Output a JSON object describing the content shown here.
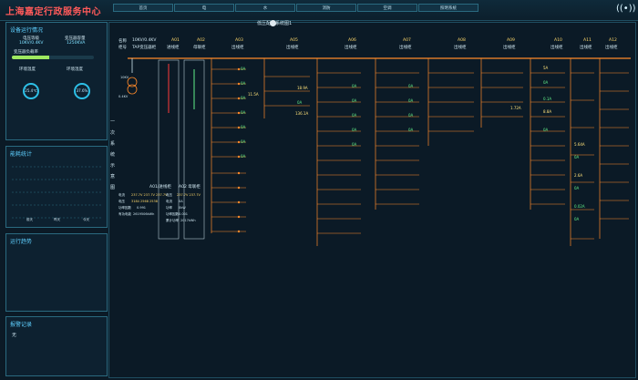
{
  "app": {
    "title": "上海嘉定行政服务中心"
  },
  "nav": [
    "首页",
    "电",
    "水",
    "消防",
    "空调",
    "照明系统"
  ],
  "header_icons": [
    "alarm-icon"
  ],
  "left": {
    "panel1": {
      "title": "设备运行情况",
      "stats": [
        {
          "label": "电压等级",
          "value": "10KV/0.4KV"
        },
        {
          "label": "变压器容量",
          "value": "1250KVA"
        }
      ],
      "load": {
        "label": "变压器负载率",
        "value": 0.45
      },
      "temp_label": "环境温度",
      "humid_label": "环境湿度",
      "temp": "25.4℃",
      "humid": "37.6%"
    },
    "panel2": {
      "title": "能耗统计",
      "x_labels": [
        "前天",
        "昨天",
        "今天"
      ]
    },
    "panel3": {
      "title": "运行趋势"
    },
    "panel4": {
      "title": "报警记录",
      "text": "无"
    }
  },
  "diagram": {
    "title": "低压配电系统图1",
    "row_labels": [
      "名称",
      "柜号"
    ],
    "header_values": [
      "10KV/0.4KV",
      "TAP变压器柜"
    ],
    "side_label": "一次系统示意图",
    "cabinets": [
      {
        "code": "A01",
        "name": "进线柜"
      },
      {
        "code": "A02",
        "name": "母联柜"
      },
      {
        "code": "A03",
        "name": "出线柜"
      },
      {
        "code": "A05",
        "name": "出线柜"
      },
      {
        "code": "A06",
        "name": "出线柜"
      },
      {
        "code": "A07",
        "name": "出线柜"
      },
      {
        "code": "A08",
        "name": "出线柜"
      },
      {
        "code": "A09",
        "name": "出线柜"
      },
      {
        "code": "A10",
        "name": "出线柜"
      },
      {
        "code": "A11",
        "name": "出线柜"
      },
      {
        "code": "A12",
        "name": "出线柜"
      }
    ],
    "transformer_labels": [
      "10KV",
      "0.4KV"
    ],
    "bottom_labels": [
      "A01/进线柜",
      "A02 母联柜"
    ],
    "meter_left": {
      "rows": [
        {
          "label": "电流",
          "value": "237.7V  237.7V  237.7V"
        },
        {
          "label": "电压",
          "value": "3184  2568  2538"
        },
        {
          "label": "功率因数",
          "value": "0.991"
        },
        {
          "label": "有功电能",
          "value": "2619506kWh"
        }
      ]
    },
    "meter_right": {
      "rows": [
        {
          "label": "电压",
          "value": "237.7V  237.7V"
        },
        {
          "label": "电流",
          "value": "0A"
        },
        {
          "label": "功率",
          "value": "0kW"
        },
        {
          "label": "功率因数",
          "value": "0.001"
        },
        {
          "label": "累计功率",
          "value": "2017kWh"
        }
      ]
    },
    "amp_samples": [
      "0A",
      "0A",
      "0A",
      "11.5A",
      "0A",
      "0A",
      "0A",
      "0A",
      "18.9A",
      "0A",
      "136.1A",
      "0A",
      "0A",
      "0A",
      "0A",
      "0A",
      "0A",
      "0A",
      "0A",
      "0A",
      "1.72A",
      "5A",
      "0A",
      "0.1A",
      "8.8A",
      "0A",
      "5.64A",
      "0A",
      "2.6A",
      "0A",
      "0.02A",
      "0A"
    ]
  }
}
